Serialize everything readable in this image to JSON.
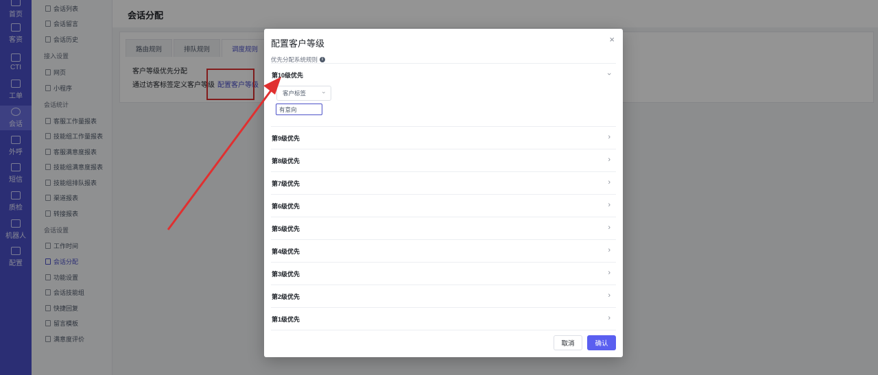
{
  "rail": [
    {
      "label": "首页",
      "icon": "home-icon"
    },
    {
      "label": "客资",
      "icon": "users-icon"
    },
    {
      "label": "CTI",
      "icon": "phone-grid-icon"
    },
    {
      "label": "工单",
      "icon": "ticket-icon"
    },
    {
      "label": "会话",
      "icon": "chat-icon"
    },
    {
      "label": "外呼",
      "icon": "outbound-call-icon"
    },
    {
      "label": "短信",
      "icon": "sms-icon"
    },
    {
      "label": "质检",
      "icon": "quality-icon"
    },
    {
      "label": "机器人",
      "icon": "robot-icon"
    },
    {
      "label": "配置",
      "icon": "config-icon"
    }
  ],
  "sidebar": {
    "items": [
      "会话列表",
      "会话留言",
      "会话历史"
    ],
    "group_access": "接入设置",
    "access_items": [
      "网页",
      "小程序"
    ],
    "group_stats": "会话统计",
    "stats_items": [
      "客服工作量报表",
      "技能组工作量报表",
      "客服满意度报表",
      "技能组满意度报表",
      "技能组排队报表",
      "渠道报表",
      "转接报表"
    ],
    "group_settings": "会话设置",
    "settings_items": [
      "工作时间",
      "会话分配",
      "功能设置",
      "会话技能组",
      "快捷回复",
      "留言模板",
      "满意度评价"
    ]
  },
  "page": {
    "title": "会话分配",
    "tabs": [
      "路由规则",
      "排队规则",
      "调度规则"
    ],
    "rule_title": "客户等级优先分配",
    "rule_desc": "通过访客标签定义客户等级",
    "rule_link": "配置客户等级"
  },
  "modal": {
    "title": "配置客户等级",
    "close": "×",
    "subtitle": "优先分配系统规则",
    "info": "i",
    "levels": [
      "第10级优先",
      "第9级优先",
      "第8级优先",
      "第7级优先",
      "第6级优先",
      "第5级优先",
      "第4级优先",
      "第3级优先",
      "第2级优先",
      "第1级优先"
    ],
    "select_value": "客户标签",
    "tag_value": "有意向",
    "cancel": "取消",
    "confirm": "确认"
  },
  "colors": {
    "accent": "#4b50c8",
    "annotation": "#e03030"
  }
}
